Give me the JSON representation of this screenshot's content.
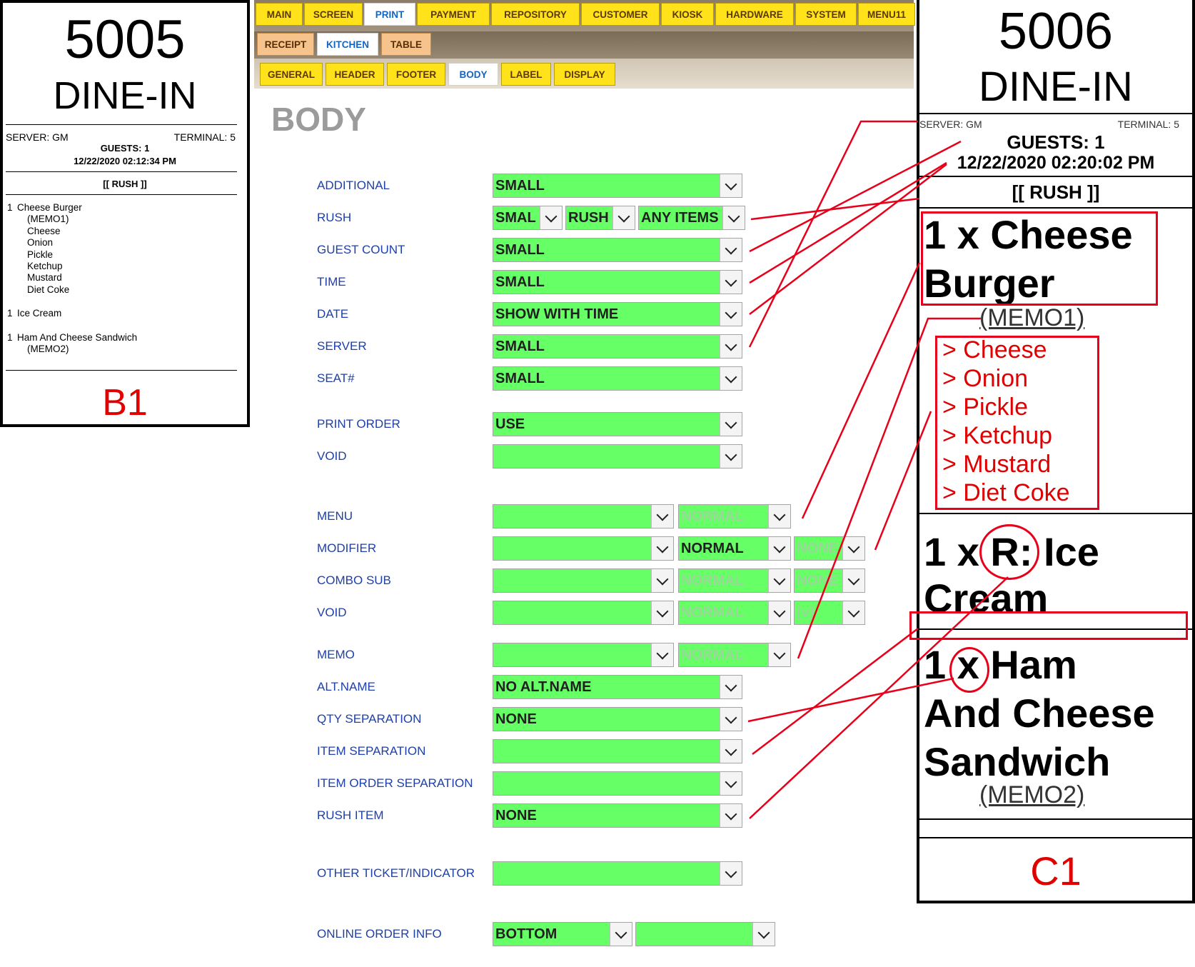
{
  "receipt_b1": {
    "order_number": "5005",
    "order_type": "DINE-IN",
    "server": "SERVER: GM",
    "terminal": "TERMINAL: 5",
    "guests": "GUESTS: 1",
    "datetime": "12/22/2020 02:12:34 PM",
    "rush": "[[ RUSH ]]",
    "lines": [
      {
        "qty": "1",
        "text": "Cheese Burger"
      },
      {
        "qty": "",
        "text": "(MEMO1)"
      },
      {
        "qty": "",
        "text": "Cheese"
      },
      {
        "qty": "",
        "text": "Onion"
      },
      {
        "qty": "",
        "text": "Pickle"
      },
      {
        "qty": "",
        "text": "Ketchup"
      },
      {
        "qty": "",
        "text": "Mustard"
      },
      {
        "qty": "",
        "text": "Diet Coke"
      },
      {
        "qty": "1",
        "text": "Ice Cream"
      },
      {
        "qty": "1",
        "text": "Ham And Cheese Sandwich"
      },
      {
        "qty": "",
        "text": "(MEMO2)"
      }
    ],
    "tag": "B1"
  },
  "tabs": {
    "main": [
      "MAIN",
      "SCREEN",
      "PRINT",
      "PAYMENT",
      "REPOSITORY",
      "CUSTOMER",
      "KIOSK",
      "HARDWARE",
      "SYSTEM",
      "MENU11"
    ],
    "print": [
      "RECEIPT",
      "KITCHEN",
      "TABLE"
    ],
    "kitchen": [
      "GENERAL",
      "HEADER",
      "FOOTER",
      "BODY",
      "LABEL",
      "DISPLAY"
    ]
  },
  "page_title": "BODY",
  "settings": {
    "additional": {
      "label": "ADDITIONAL",
      "value": "SMALL"
    },
    "rush": {
      "label": "RUSH",
      "size": "SMAL",
      "text": "RUSH",
      "scope": "ANY ITEMS"
    },
    "guest_count": {
      "label": "GUEST COUNT",
      "value": "SMALL"
    },
    "time": {
      "label": "TIME",
      "value": "SMALL"
    },
    "date": {
      "label": "DATE",
      "value": "SHOW WITH TIME"
    },
    "server": {
      "label": "SERVER",
      "value": "SMALL"
    },
    "seat": {
      "label": "SEAT#",
      "value": "SMALL"
    },
    "print_order": {
      "label": "PRINT ORDER",
      "value": "USE"
    },
    "void_top": {
      "label": "VOID",
      "value": ""
    },
    "menu": {
      "label": "MENU",
      "value": "",
      "style": "NORMAL"
    },
    "modifier": {
      "label": "MODIFIER",
      "value": "",
      "style": "NORMAL",
      "prefix": "NONE"
    },
    "combo_sub": {
      "label": "COMBO SUB",
      "value": "",
      "style": "NORMAL",
      "prefix": "NONE"
    },
    "void_item": {
      "label": "VOID",
      "value": "",
      "style": "NORMAL",
      "prefix": "[v]"
    },
    "memo": {
      "label": "MEMO",
      "value": "",
      "style": "NORMAL"
    },
    "alt_name": {
      "label": "ALT.NAME",
      "value": "NO ALT.NAME"
    },
    "qty_separation": {
      "label": "QTY SEPARATION",
      "value": "NONE"
    },
    "item_separation": {
      "label": "ITEM SEPARATION",
      "value": ""
    },
    "item_order_separation": {
      "label": "ITEM ORDER SEPARATION",
      "value": ""
    },
    "rush_item": {
      "label": "RUSH ITEM",
      "value": "NONE"
    },
    "other_ticket": {
      "label": "OTHER TICKET/INDICATOR",
      "value": ""
    },
    "online_order_info": {
      "label": "ONLINE ORDER INFO",
      "value": "BOTTOM",
      "extra": ""
    }
  },
  "receipt_c1": {
    "order_number": "5006",
    "order_type": "DINE-IN",
    "server": "SERVER: GM",
    "terminal": "TERMINAL: 5",
    "guests": "GUESTS: 1",
    "datetime": "12/22/2020 02:20:02 PM",
    "rush": "[[ RUSH ]]",
    "item1_line1": "1 x Cheese",
    "item1_line2": "Burger",
    "memo1": "(MEMO1)",
    "modifiers": [
      "> Cheese",
      "> Onion",
      "> Pickle",
      "> Ketchup",
      "> Mustard",
      "> Diet Coke"
    ],
    "item2_line1": "1 x R: Ice",
    "item2_line2": "Cream",
    "item3_line1": "1 x Ham",
    "item3_line2": "And Cheese",
    "item3_line3": "Sandwich",
    "memo2": "(MEMO2)",
    "tag": "C1"
  },
  "colors": {
    "dropdown": "#66ff66",
    "tab": "#ffe21a",
    "annotation": "#e8001a",
    "label": "#1e40a8"
  }
}
